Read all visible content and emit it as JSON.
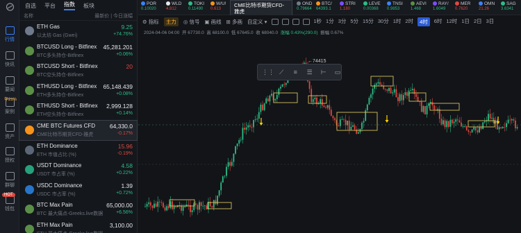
{
  "rail": {
    "items": [
      {
        "label": "行情",
        "icon": "market-icon"
      },
      {
        "label": "快讯",
        "icon": "flash-news-icon"
      },
      {
        "label": "要闻",
        "icon": "news-icon"
      },
      {
        "label": "案例",
        "icon": "case-icon",
        "badge": "年21%"
      },
      {
        "label": "资产",
        "icon": "asset-icon"
      },
      {
        "label": "授权",
        "icon": "auth-icon"
      },
      {
        "label": "群聊",
        "icon": "chat-icon"
      },
      {
        "label": "钱包",
        "icon": "wallet-icon",
        "badge": "HOT"
      },
      {
        "label": "",
        "icon": "settings-icon"
      }
    ]
  },
  "panel": {
    "tabs": [
      "自选",
      "平台",
      "指数",
      "板块"
    ],
    "active_tab": "指数",
    "col_name": "名称",
    "col_price": "最新价",
    "col_change": "今日涨幅",
    "rows": [
      {
        "sym": "ETH Gas",
        "sub": "以太坊 Gas (Gwei)",
        "price": "9.25",
        "chg": "+74.76%",
        "dir": "up",
        "logo": "#6f7a8c"
      },
      {
        "sym": "BTCUSD Long - Bitfinex",
        "sub": "BTC多头持仓-Bitfinex",
        "price": "45,281.201",
        "chg": "+0.06%",
        "dir": "up",
        "logo": "#5b8f47"
      },
      {
        "sym": "BTCUSD Short - Bitfinex",
        "sub": "BTC空头持仓-Bitfinex",
        "price": "20",
        "chg": "",
        "dir": "down",
        "logo": "#5b8f47"
      },
      {
        "sym": "ETHUSD Long - Bitfinex",
        "sub": "ETH多头持仓-Bitfinex",
        "price": "65,148.439",
        "chg": "+0.08%",
        "dir": "up",
        "logo": "#5b8f47"
      },
      {
        "sym": "ETHUSD Short - Bitfinex",
        "sub": "ETH空头持仓-Bitfinex",
        "price": "2,999.128",
        "chg": "+0.14%",
        "dir": "up",
        "logo": "#5b8f47"
      },
      {
        "sym": "CME BTC Futures CFD",
        "sub": "CME比特币期货CFD-雅虎",
        "price": "64,330.0",
        "chg": "-0.17%",
        "dir": "down",
        "logo": "#f7931a"
      },
      {
        "sym": "ETH Dominance",
        "sub": "ETH 市值占比 (%)",
        "price": "15.96",
        "chg": "-0.19%",
        "dir": "down",
        "logo": "#5b6677"
      },
      {
        "sym": "USDT Dominance",
        "sub": "USDT 市占率 (%)",
        "price": "4.58",
        "chg": "+0.22%",
        "dir": "up",
        "logo": "#26a17b"
      },
      {
        "sym": "USDC Dominance",
        "sub": "USDC 市占率 (%)",
        "price": "1.39",
        "chg": "+0.72%",
        "dir": "up",
        "logo": "#2775ca"
      },
      {
        "sym": "BTC Max Pain",
        "sub": "BTC 最大痛点-Greeks.live数据",
        "price": "65,000.00",
        "chg": "+6.56%",
        "dir": "up",
        "logo": "#5b8f47"
      },
      {
        "sym": "ETH Max Pain",
        "sub": "ETH 最大痛点-Greeks.live数据",
        "price": "3,100.00",
        "chg": "",
        "dir": "up",
        "logo": "#5b8f47"
      }
    ]
  },
  "ticker": [
    {
      "n": "POR",
      "v": "0.10020",
      "dir": "up",
      "c": "#3b82f6"
    },
    {
      "n": "WLD",
      "v": "4.812",
      "dir": "down",
      "c": "#e6e8eb"
    },
    {
      "n": "TOKI",
      "v": "0.11490",
      "dir": "up",
      "c": "#2ebd85"
    },
    {
      "n": "W/U!",
      "v": "0.613",
      "dir": "down",
      "c": "#f7931a"
    },
    {
      "n": "OND",
      "v": "0.79664",
      "dir": "up",
      "c": "#6f7a8c"
    },
    {
      "n": "BTC/",
      "v": "64393.1",
      "dir": "up",
      "c": "#f7931a"
    },
    {
      "n": "STRI",
      "v": "1.180",
      "dir": "down",
      "c": "#7c4dff"
    },
    {
      "n": "LEVE",
      "v": "0.00368",
      "dir": "up",
      "c": "#2ebd85"
    },
    {
      "n": "TNSI",
      "v": "0.9853",
      "dir": "up",
      "c": "#3b82f6"
    },
    {
      "n": "AEVI",
      "v": "1.468",
      "dir": "up",
      "c": "#5b8f47"
    },
    {
      "n": "RAY/",
      "v": "1.6049",
      "dir": "up",
      "c": "#7c4dff"
    },
    {
      "n": "MER",
      "v": "0.7620",
      "dir": "down",
      "c": "#e0483e"
    },
    {
      "n": "OMN",
      "v": "21.26",
      "dir": "down",
      "c": "#3b82f6"
    },
    {
      "n": "SAG",
      "v": "3.6341",
      "dir": "up",
      "c": "#2ebd85"
    }
  ],
  "active_tab": {
    "line1": "CME比特币期货CFD-",
    "line2": "雅虎"
  },
  "toolbar": {
    "indicator": "指标",
    "main": "主力",
    "signal": "信号",
    "alert": "画线",
    "multi": "多画",
    "custom": "自定义",
    "intervals": [
      "1秒",
      "1分",
      "3分",
      "5分",
      "15分",
      "30分",
      "1时",
      "2时",
      "4时",
      "6时",
      "12时",
      "1日",
      "2日",
      "3日"
    ],
    "active_interval": "4时"
  },
  "infobar": {
    "time": "2024-04-06 04:00",
    "o": "开 67730.0",
    "h": "高 68100.0",
    "l": "低 67645.0",
    "c": "收 68040.0",
    "chg": "涨幅 0.43%(290.0)",
    "amp": "振幅 0.67%"
  },
  "chart_data": {
    "type": "candlestick",
    "annotations": [
      "74415"
    ],
    "colors": {
      "up": "#2ebd85",
      "down": "#e0483e",
      "box": "#d7c35a",
      "arrow": "#ffd400"
    }
  }
}
